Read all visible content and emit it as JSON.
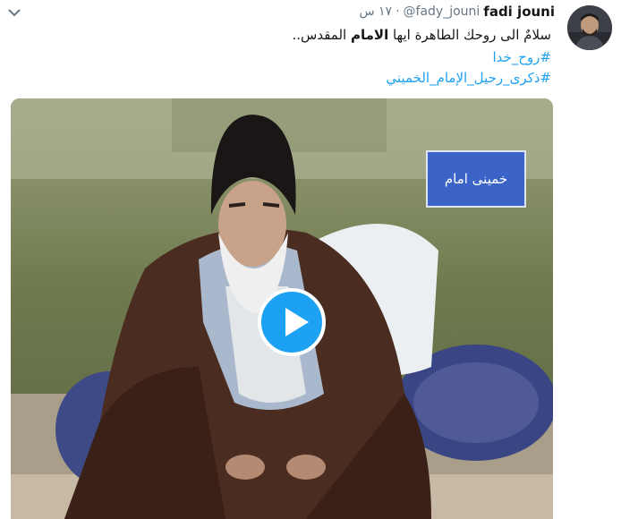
{
  "tweet": {
    "author_name": "fadi jouni",
    "handle": "@fady_jouni",
    "separator": "·",
    "time": "١٧ س",
    "text_before": "سلامٌ الى روحك الطاهرة ايها ",
    "text_bold": "الامام",
    "text_after": " المقدس..",
    "hashtag_1": "#روح_خدا",
    "hashtag_2": "#ذكرى_رحيل_الإمام_الخميني"
  },
  "media": {
    "caption": "خمینی امام",
    "type": "video"
  },
  "icons": {
    "menu": "chevron-down-icon",
    "play": "play-icon"
  },
  "colors": {
    "link": "#1da1f2",
    "text": "#14171a",
    "muted": "#657786",
    "play": "#1da1f2"
  }
}
